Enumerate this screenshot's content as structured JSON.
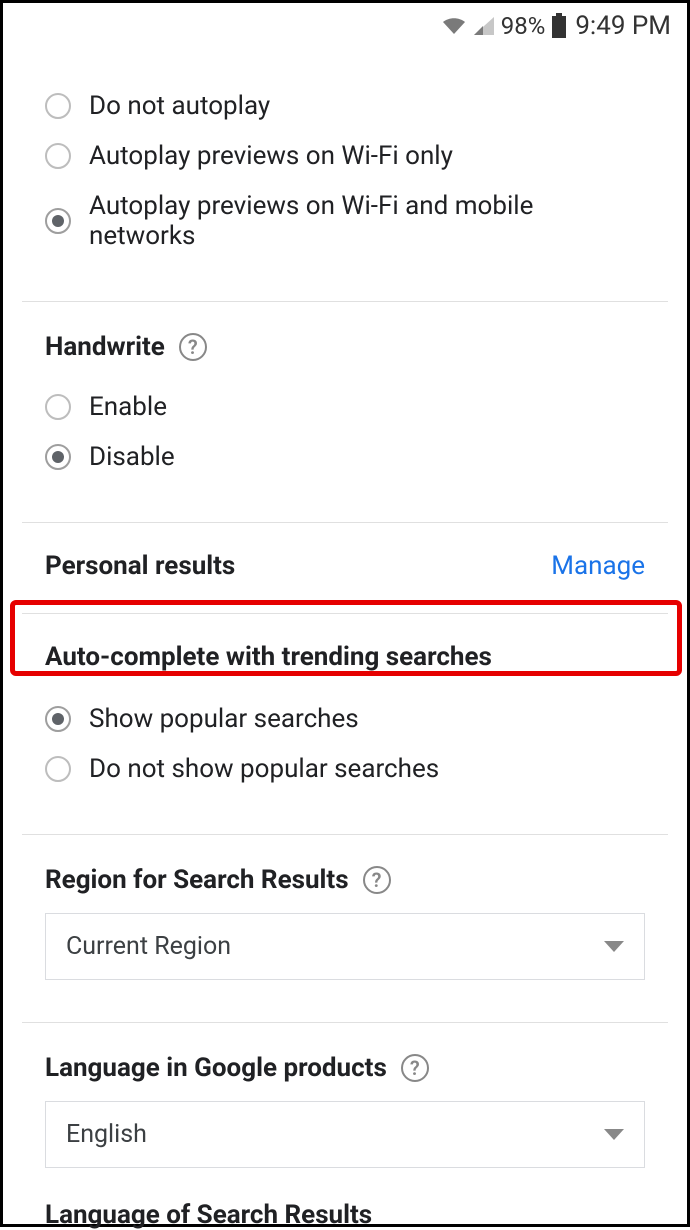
{
  "status": {
    "battery_pct": "98%",
    "time": "9:49 PM"
  },
  "autoplay": {
    "options": {
      "none": "Do not autoplay",
      "wifi": "Autoplay previews on Wi-Fi only",
      "all": "Autoplay previews on Wi-Fi and mobile networks"
    },
    "selected": "all"
  },
  "handwrite": {
    "title": "Handwrite",
    "options": {
      "enable": "Enable",
      "disable": "Disable"
    },
    "selected": "disable"
  },
  "personal": {
    "title": "Personal results",
    "manage": "Manage"
  },
  "autocomplete": {
    "title": "Auto-complete with trending searches",
    "options": {
      "show": "Show popular searches",
      "hide": "Do not show popular searches"
    },
    "selected": "show"
  },
  "region": {
    "title": "Region for Search Results",
    "selected": "Current Region"
  },
  "language_products": {
    "title": "Language in Google products",
    "selected": "English"
  },
  "language_results": {
    "title": "Language of Search Results"
  }
}
